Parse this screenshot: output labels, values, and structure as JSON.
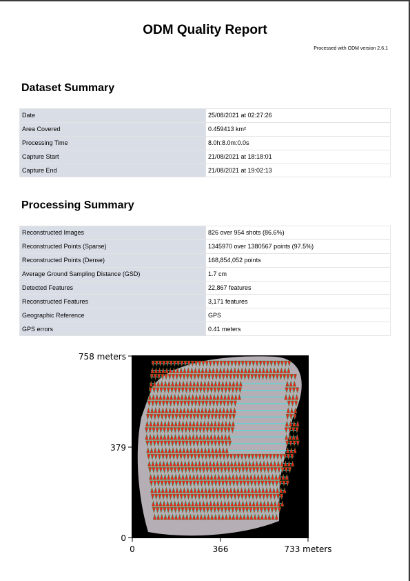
{
  "report": {
    "title": "ODM Quality Report",
    "version": "Processed with ODM version 2.6.1"
  },
  "dataset_summary": {
    "heading": "Dataset Summary",
    "rows": [
      {
        "label": "Date",
        "value": "25/08/2021 at 02:27:26"
      },
      {
        "label": "Area Covered",
        "value": "0.459413 km²"
      },
      {
        "label": "Processing Time",
        "value": "8.0h:8.0m:0.0s"
      },
      {
        "label": "Capture Start",
        "value": "21/08/2021 at 18:18:01"
      },
      {
        "label": "Capture End",
        "value": "21/08/2021 at 19:02:13"
      }
    ]
  },
  "processing_summary": {
    "heading": "Processing Summary",
    "rows": [
      {
        "label": "Reconstructed Images",
        "value": "826 over 954 shots (86.6%)"
      },
      {
        "label": "Reconstructed Points (Sparse)",
        "value": "1345970 over 1380567 points (97.5%)"
      },
      {
        "label": "Reconstructed Points (Dense)",
        "value": "168,854,052 points"
      },
      {
        "label": "Average Ground Sampling Distance (GSD)",
        "value": "1.7 cm"
      },
      {
        "label": "Detected Features",
        "value": "22,867 features"
      },
      {
        "label": "Reconstructed Features",
        "value": "3,171 features"
      },
      {
        "label": "Geographic Reference",
        "value": "GPS"
      },
      {
        "label": "GPS errors",
        "value": "0.41 meters"
      }
    ]
  },
  "map": {
    "y_ticks": [
      "758 meters",
      "379",
      "0"
    ],
    "x_ticks": [
      "0",
      "366",
      "733 meters"
    ],
    "colors": {
      "background": "#000000",
      "point_cloud": "#c9c2c9",
      "camera_marker": "#e8241c",
      "camera_edge": "#2f8f3a",
      "flight_line": "#3fe0e0"
    }
  }
}
